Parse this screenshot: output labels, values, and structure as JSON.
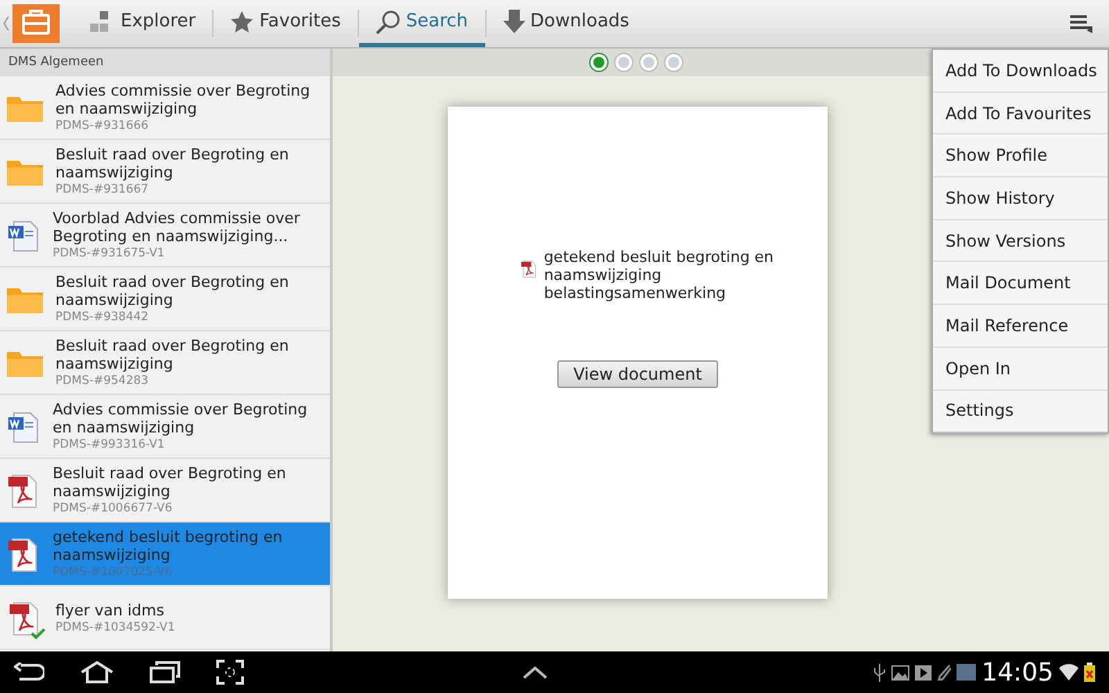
{
  "tabs": [
    {
      "label": "Explorer",
      "kind": "explorer",
      "selected": false
    },
    {
      "label": "Favorites",
      "kind": "favorites",
      "selected": false
    },
    {
      "label": "Search",
      "kind": "search",
      "selected": true
    },
    {
      "label": "Downloads",
      "kind": "downloads",
      "selected": false
    }
  ],
  "sidebar": {
    "header": "DMS Algemeen",
    "items": [
      {
        "kind": "folder",
        "title": "Advies commissie over Begroting en naamswijziging",
        "code": "PDMS-#931666",
        "selected": false,
        "synced": false
      },
      {
        "kind": "folder",
        "title": "Besluit raad over Begroting en naamswijziging",
        "code": "PDMS-#931667",
        "selected": false,
        "synced": false
      },
      {
        "kind": "word",
        "title": "Voorblad Advies commissie over Begroting en naamswijziging...",
        "code": "PDMS-#931675-V1",
        "selected": false,
        "synced": false
      },
      {
        "kind": "folder",
        "title": "Besluit raad over Begroting en naamswijziging",
        "code": "PDMS-#938442",
        "selected": false,
        "synced": false
      },
      {
        "kind": "folder",
        "title": "Besluit raad over Begroting en naamswijziging",
        "code": "PDMS-#954283",
        "selected": false,
        "synced": false
      },
      {
        "kind": "word",
        "title": "Advies commissie over Begroting en naamswijziging",
        "code": "PDMS-#993316-V1",
        "selected": false,
        "synced": false
      },
      {
        "kind": "pdf",
        "title": "Besluit raad over Begroting en naamswijziging",
        "code": "PDMS-#1006677-V6",
        "selected": false,
        "synced": false
      },
      {
        "kind": "pdf",
        "title": "getekend besluit begroting en naamswijziging",
        "code": "PDMS-#1007025-V6",
        "selected": true,
        "synced": false
      },
      {
        "kind": "pdf",
        "title": "flyer van idms",
        "code": "PDMS-#1034592-V1",
        "selected": false,
        "synced": true
      }
    ]
  },
  "pager": [
    {
      "selected": true
    },
    {
      "selected": false
    },
    {
      "selected": false
    },
    {
      "selected": false
    }
  ],
  "document": {
    "title": "getekend besluit begroting en naamswijziging belastingsamenwerking",
    "button": "View document"
  },
  "menu": [
    "Add To Downloads",
    "Add To Favourites",
    "Show Profile",
    "Show History",
    "Show Versions",
    "Mail Document",
    "Mail Reference",
    "Open In",
    "Settings"
  ],
  "status_bar": {
    "time": "14:05"
  }
}
